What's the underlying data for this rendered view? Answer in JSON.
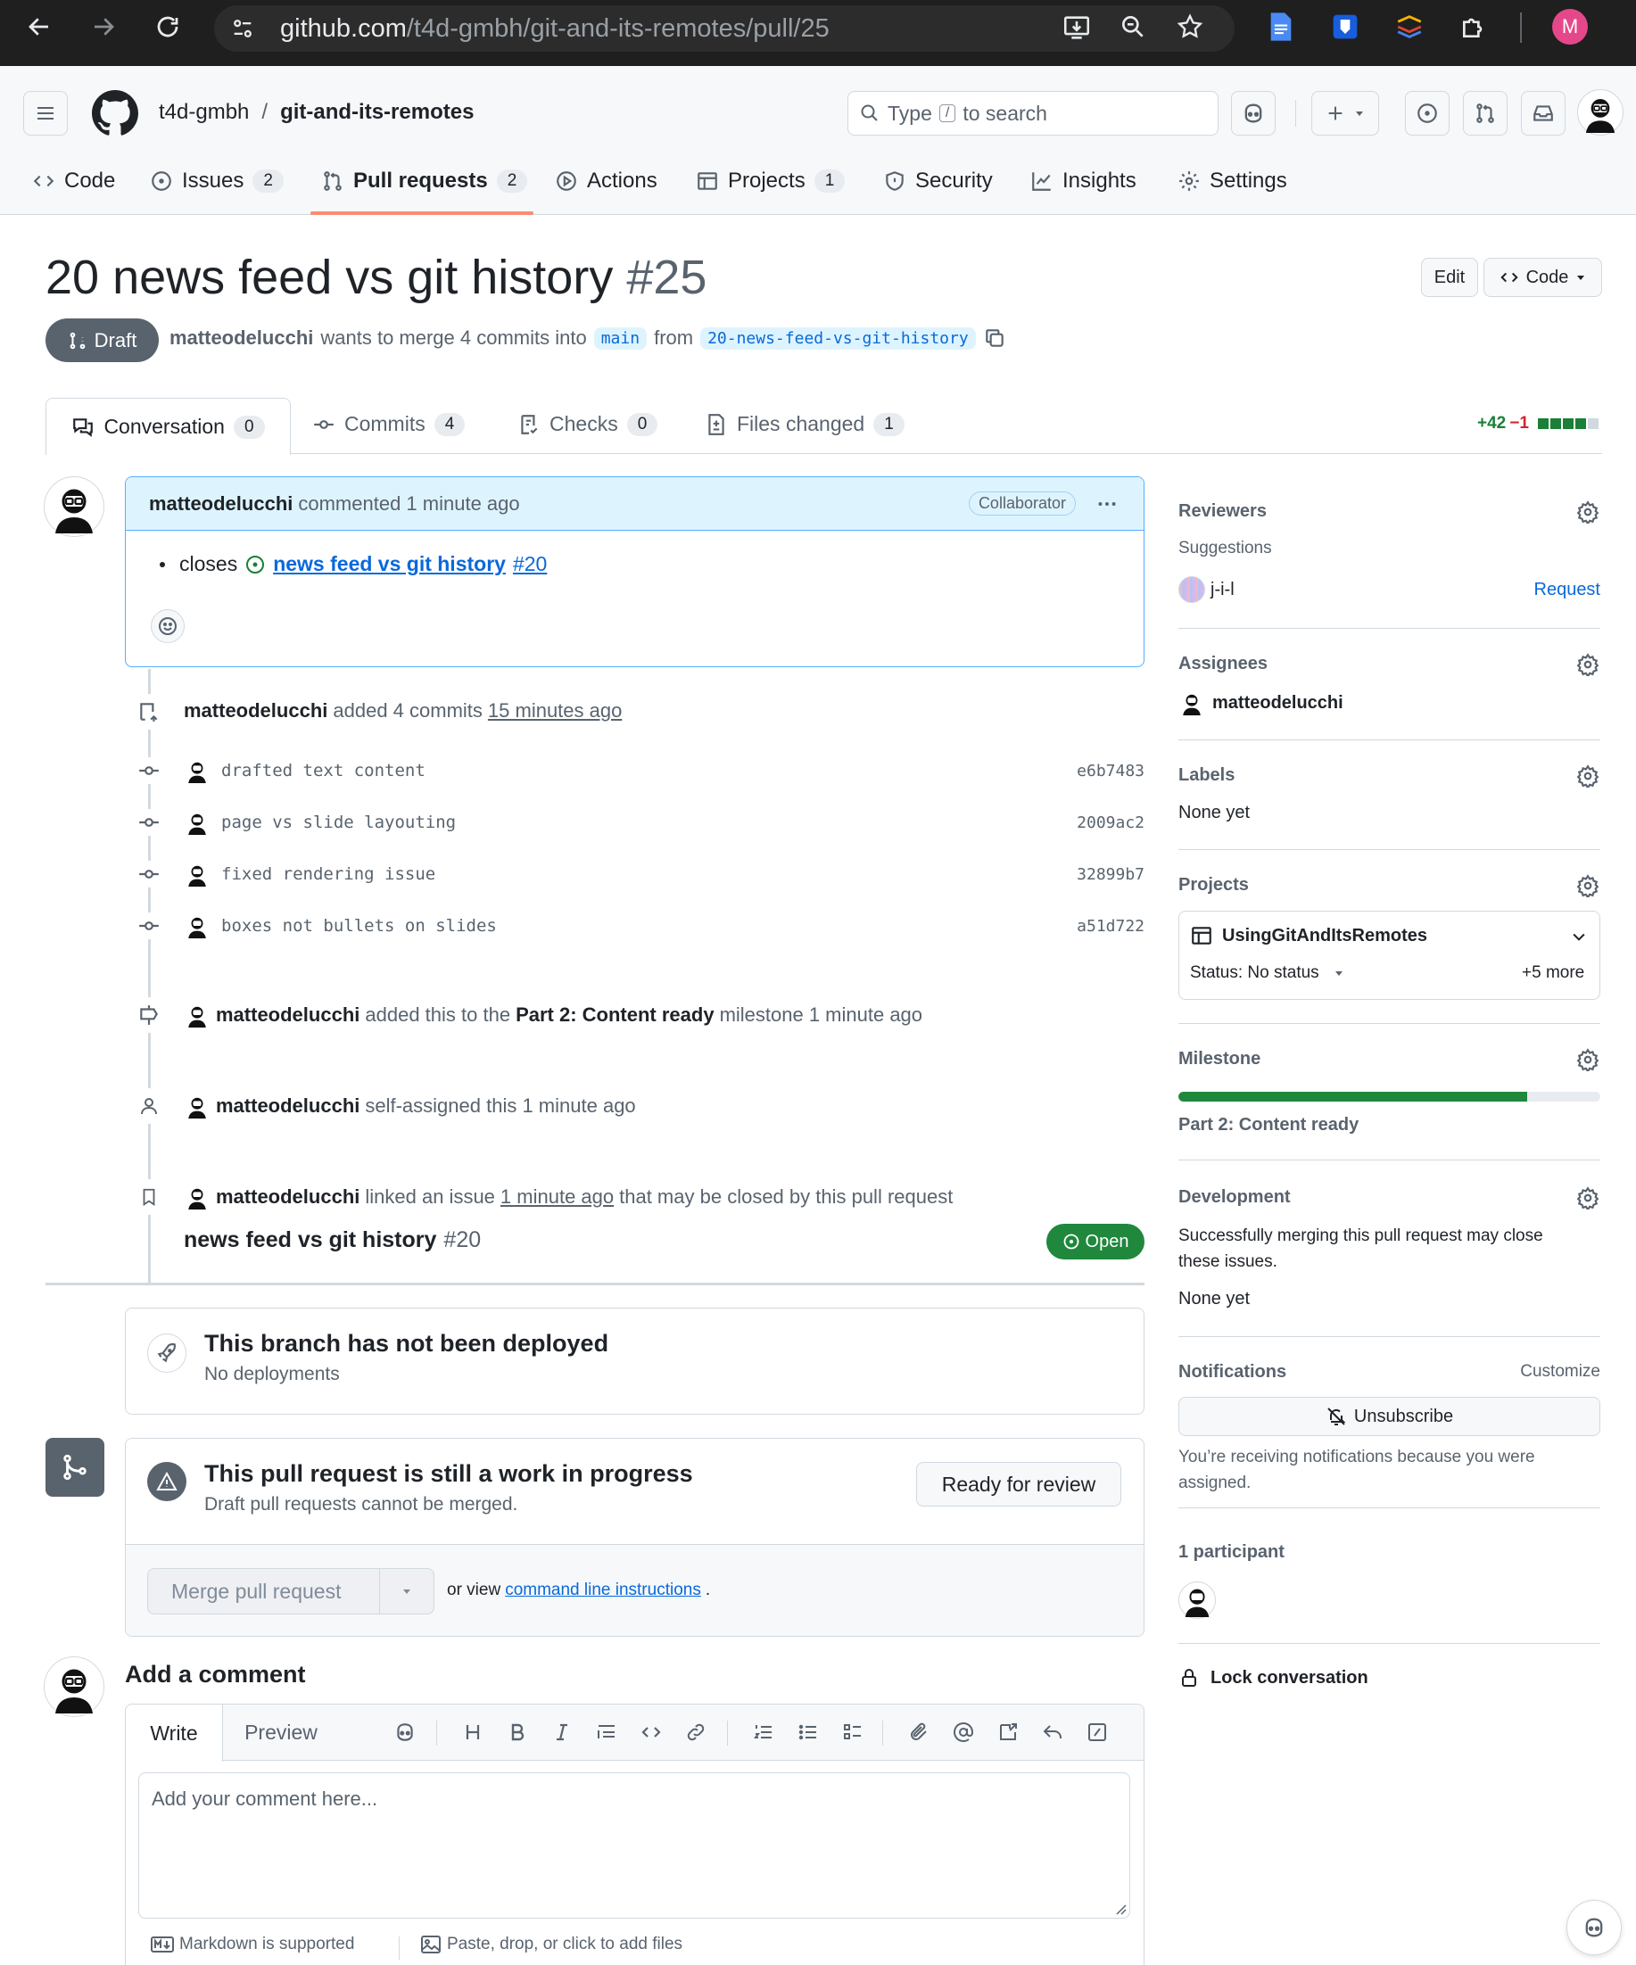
{
  "browser": {
    "url_host": "github.com",
    "url_path": "/t4d-gmbh/git-and-its-remotes/pull/25",
    "profile_initial": "M"
  },
  "header": {
    "owner": "t4d-gmbh",
    "separator": "/",
    "repo": "git-and-its-remotes",
    "search_type": "Type",
    "search_key": "/",
    "search_rest": "to search"
  },
  "nav": {
    "tabs": [
      {
        "label": "Code",
        "count": ""
      },
      {
        "label": "Issues",
        "count": "2"
      },
      {
        "label": "Pull requests",
        "count": "2"
      },
      {
        "label": "Actions",
        "count": ""
      },
      {
        "label": "Projects",
        "count": "1"
      },
      {
        "label": "Security",
        "count": ""
      },
      {
        "label": "Insights",
        "count": ""
      },
      {
        "label": "Settings",
        "count": ""
      }
    ]
  },
  "pr": {
    "title": "20 news feed vs git history",
    "number": "#25",
    "edit_label": "Edit",
    "code_label": "Code",
    "state": "Draft",
    "author": "matteodelucchi",
    "merge_text": "wants to merge 4 commits into",
    "base": "main",
    "from_text": "from",
    "head": "20-news-feed-vs-git-history"
  },
  "prtabs": {
    "conversation": {
      "label": "Conversation",
      "count": "0"
    },
    "commits": {
      "label": "Commits",
      "count": "4"
    },
    "checks": {
      "label": "Checks",
      "count": "0"
    },
    "files": {
      "label": "Files changed",
      "count": "1"
    },
    "additions": "+42",
    "deletions": "−1"
  },
  "comment": {
    "author": "matteodelucchi",
    "action": "commented 1 minute ago",
    "badge": "Collaborator",
    "closes": "closes",
    "issue_title": "news feed vs git history",
    "issue_num": "#20"
  },
  "timeline": {
    "commits_event": {
      "author": "matteodelucchi",
      "text": "added 4 commits",
      "time": "15 minutes ago"
    },
    "commits": [
      {
        "message": "drafted text content",
        "sha": "e6b7483"
      },
      {
        "message": "page vs slide layouting",
        "sha": "2009ac2"
      },
      {
        "message": "fixed rendering issue",
        "sha": "32899b7"
      },
      {
        "message": "boxes not bullets on slides",
        "sha": "a51d722"
      }
    ],
    "milestone_event": {
      "author": "matteodelucchi",
      "pre": "added this to the",
      "milestone": "Part 2: Content ready",
      "post": "milestone 1 minute ago"
    },
    "assign_event": {
      "author": "matteodelucchi",
      "text": "self-assigned this 1 minute ago"
    },
    "link_event": {
      "author": "matteodelucchi",
      "pre": "linked an issue",
      "time": "1 minute ago",
      "post": "that may be closed by this pull request",
      "issue_title": "news feed vs git history",
      "issue_num": "#20",
      "issue_state": "Open"
    }
  },
  "deploy": {
    "title": "This branch has not been deployed",
    "subtitle": "No deployments"
  },
  "merge": {
    "title": "This pull request is still a work in progress",
    "subtitle": "Draft pull requests cannot be merged.",
    "ready_label": "Ready for review",
    "merge_label": "Merge pull request",
    "or_view": "or view",
    "cli_link": "command line instructions",
    "period": "."
  },
  "addcomment": {
    "heading": "Add a comment",
    "write_tab": "Write",
    "preview_tab": "Preview",
    "placeholder": "Add your comment here...",
    "markdown_note": "Markdown is supported",
    "attach_note": "Paste, drop, or click to add files"
  },
  "sidebar": {
    "reviewers": {
      "heading": "Reviewers",
      "suggestions": "Suggestions",
      "suggested_user": "j-i-l",
      "request": "Request"
    },
    "assignees": {
      "heading": "Assignees",
      "user": "matteodelucchi"
    },
    "labels": {
      "heading": "Labels",
      "value": "None yet"
    },
    "projects": {
      "heading": "Projects",
      "project": "UsingGitAndItsRemotes",
      "status": "Status: No status",
      "more": "+5 more"
    },
    "milestone": {
      "heading": "Milestone",
      "title": "Part 2: Content ready",
      "progress": 0.827
    },
    "development": {
      "heading": "Development",
      "text": "Successfully merging this pull request may close these issues.",
      "value": "None yet"
    },
    "notifications": {
      "heading": "Notifications",
      "customize": "Customize",
      "button": "Unsubscribe",
      "reason": "You’re receiving notifications because you were assigned."
    },
    "participants": {
      "heading": "1 participant"
    },
    "lock": "Lock conversation"
  },
  "colors": {
    "accent": "#0969da",
    "green": "#1a7f37",
    "draft": "#59636e",
    "tab_underline": "#fd8c73"
  }
}
